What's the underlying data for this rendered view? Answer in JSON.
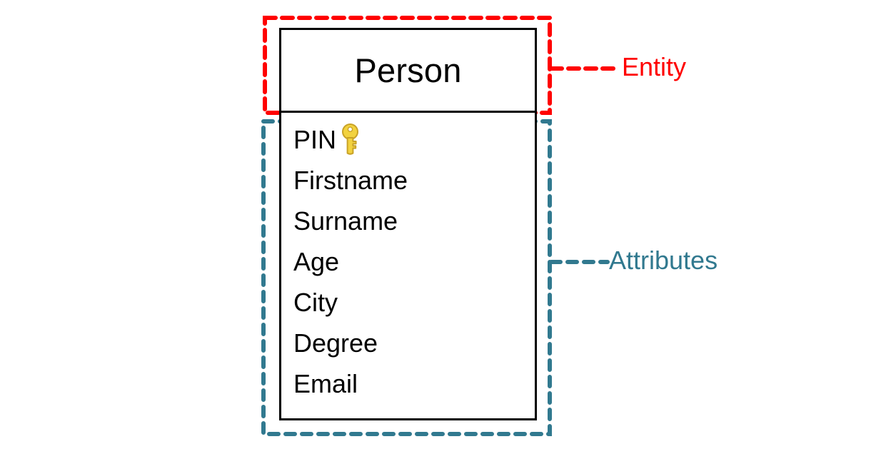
{
  "diagram": {
    "type": "entity-relationship-diagram",
    "entity": {
      "name": "Person",
      "attributes": [
        {
          "name": "PIN",
          "icon": "key-icon",
          "is_primary_key": true
        },
        {
          "name": "Firstname",
          "icon": null,
          "is_primary_key": false
        },
        {
          "name": "Surname",
          "icon": null,
          "is_primary_key": false
        },
        {
          "name": "Age",
          "icon": null,
          "is_primary_key": false
        },
        {
          "name": "City",
          "icon": null,
          "is_primary_key": false
        },
        {
          "name": "Degree",
          "icon": null,
          "is_primary_key": false
        },
        {
          "name": "Email",
          "icon": null,
          "is_primary_key": false
        }
      ]
    },
    "callouts": [
      {
        "id": "entity",
        "label": "Entity",
        "color": "#ff0000",
        "target": "entity-header-region"
      },
      {
        "id": "attributes",
        "label": "Attributes",
        "color": "#31798f",
        "target": "attribute-list-region"
      }
    ],
    "colors": {
      "entity_callout": "#ff0000",
      "attributes_callout": "#31798f",
      "box_outline": "#000000",
      "background": "#ffffff",
      "key_body": "#f7d94c",
      "key_outline": "#c9a227"
    }
  }
}
